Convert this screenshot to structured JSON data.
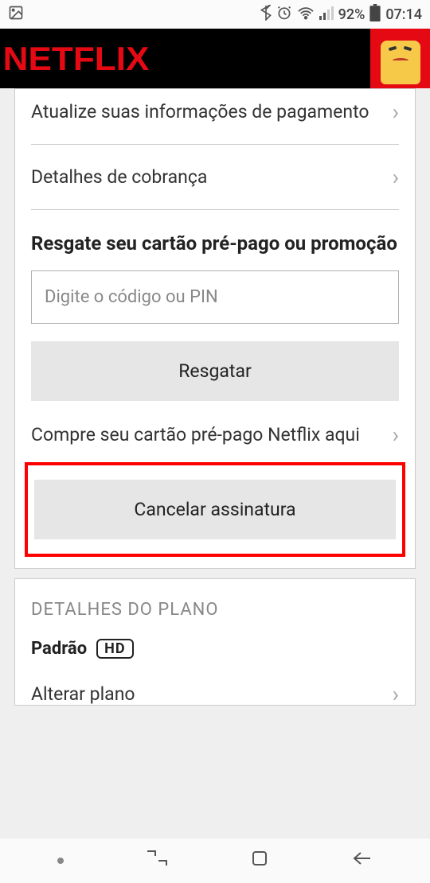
{
  "status_bar": {
    "battery_pct": "92%",
    "time": "07:14"
  },
  "header": {
    "logo_text": "NETFLIX"
  },
  "account": {
    "update_payment": "Atualize suas informações de pagamento",
    "billing_details": "Detalhes de cobrança",
    "redeem_title": "Resgate seu cartão pré-pago ou promoção",
    "redeem_placeholder": "Digite o código ou PIN",
    "redeem_button": "Resgatar",
    "buy_card_link": "Compre seu cartão pré-pago Netflix aqui",
    "cancel_button": "Cancelar assinatura"
  },
  "plan": {
    "section_heading": "DETALHES DO PLANO",
    "plan_name": "Padrão",
    "quality_badge": "HD",
    "change_plan": "Alterar plano"
  }
}
